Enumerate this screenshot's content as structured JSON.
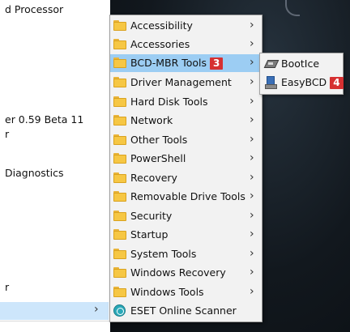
{
  "start_list": {
    "items": [
      {
        "label": "d Processor"
      },
      {
        "label": "er 0.59 Beta 11"
      },
      {
        "label": "r"
      },
      {
        "label": "Diagnostics"
      },
      {
        "label": "r"
      }
    ],
    "selected_chevron": "›"
  },
  "menu": {
    "chevron": "›",
    "items": [
      {
        "label": "Accessibility"
      },
      {
        "label": "Accessories"
      },
      {
        "label": "BCD-MBR Tools",
        "badge": "3"
      },
      {
        "label": "Driver Management"
      },
      {
        "label": "Hard Disk Tools"
      },
      {
        "label": "Network"
      },
      {
        "label": "Other Tools"
      },
      {
        "label": "PowerShell"
      },
      {
        "label": "Recovery"
      },
      {
        "label": "Removable Drive Tools"
      },
      {
        "label": "Security"
      },
      {
        "label": "Startup"
      },
      {
        "label": "System Tools"
      },
      {
        "label": "Windows Recovery"
      },
      {
        "label": "Windows Tools"
      },
      {
        "label": "ESET Online Scanner"
      }
    ]
  },
  "submenu": {
    "items": [
      {
        "label": "BootIce",
        "icon": "disk-icon"
      },
      {
        "label": "EasyBCD",
        "icon": "easybcd-icon",
        "badge": "4"
      }
    ]
  },
  "colors": {
    "menu_bg": "#f2f2f2",
    "active_bg": "#9ccdf3",
    "badge_red": "#d63031",
    "folder_yellow": "#f6c744"
  }
}
